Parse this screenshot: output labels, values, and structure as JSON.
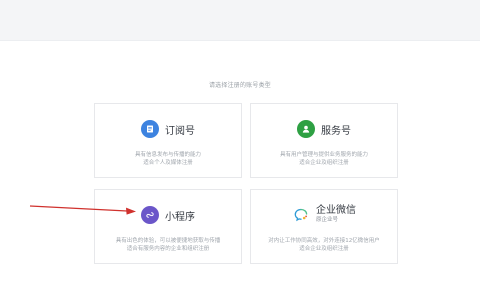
{
  "prompt": "请选择注册的账号类型",
  "cards": {
    "subscription": {
      "title": "订阅号",
      "desc_line1": "具有信息发布与传播的能力",
      "desc_line2": "适合个人及媒体注册",
      "icon": "document-icon",
      "icon_color": "#3d83e0"
    },
    "service": {
      "title": "服务号",
      "desc_line1": "具有用户管理与提供业务服务的能力",
      "desc_line2": "适合企业及组织注册",
      "icon": "person-icon",
      "icon_color": "#2ea043"
    },
    "miniprogram": {
      "title": "小程序",
      "desc_line1": "具有出色的体验，可以被便捷地获取与传播",
      "desc_line2": "适合有服务内容的企业和组织注册",
      "icon": "link-icon",
      "icon_color": "#6b56c9"
    },
    "enterprise": {
      "title": "企业微信",
      "subtitle": "原企业号",
      "desc_line1": "对内让工作协同高效，对外连接12亿微信用户",
      "desc_line2": "适合企业及组织注册",
      "icon": "enterprise-wechat-icon",
      "icon_color": "#2f9bd6"
    }
  },
  "annotation": {
    "arrow_color": "#d0312d"
  }
}
